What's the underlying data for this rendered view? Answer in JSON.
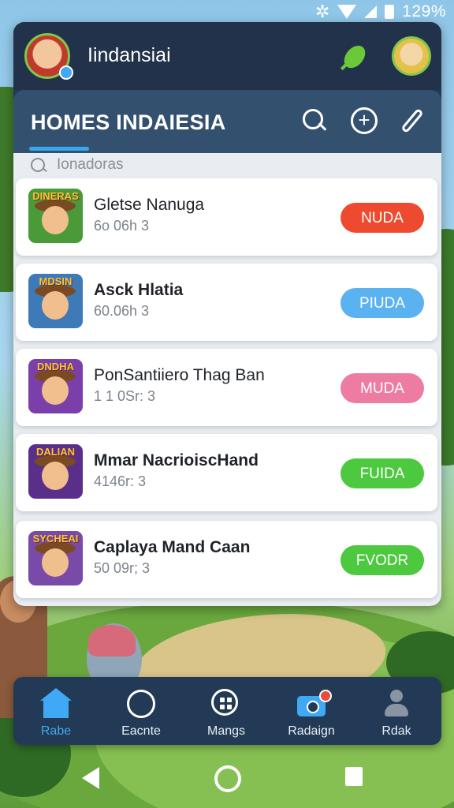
{
  "status": {
    "time": "129%"
  },
  "app": {
    "title": "Iindansiai"
  },
  "section": {
    "title": "HOMES INDAIESIA"
  },
  "search": {
    "placeholder": "Ionadoras"
  },
  "games": [
    {
      "title": "Gletse Nanuga",
      "meta": "6o 06h 3",
      "action": "NUDA",
      "action_color": "#ee4a2f",
      "thumb_text": "DINERAS",
      "thumb_bg": "#4a9a3a"
    },
    {
      "title": "Asck Hlatia",
      "meta": "60.06h 3",
      "action": "PIUDA",
      "action_color": "#5bb2f0",
      "thumb_text": "MDSIN",
      "thumb_bg": "#3f7ab8"
    },
    {
      "title": "PonSantiiero Thag Ban",
      "meta": "1 1 0Sr: 3",
      "action": "MUDA",
      "action_color": "#ee7ba1",
      "thumb_text": "DNDHA",
      "thumb_bg": "#7a3fa8"
    },
    {
      "title": "Mmar NacrioiscHand",
      "meta": "4146r: 3",
      "action": "FUIDA",
      "action_color": "#4cc93f",
      "thumb_text": "DALIAN",
      "thumb_bg": "#5a2f8a"
    },
    {
      "title": "Caplaya Mand Caan",
      "meta": "50 09r; 3",
      "action": "FVODR",
      "action_color": "#4cc93f",
      "thumb_text": "SYCHEAI",
      "thumb_bg": "#7a4aa8"
    }
  ],
  "nav": [
    {
      "label": "Rabe",
      "icon": "home-icon",
      "active": true
    },
    {
      "label": "Eacnte",
      "icon": "explore-icon",
      "active": false
    },
    {
      "label": "Mangs",
      "icon": "apps-grid-icon",
      "active": false
    },
    {
      "label": "Radaign",
      "icon": "camera-icon",
      "active": false
    },
    {
      "label": "Rdak",
      "icon": "profile-icon",
      "active": false
    }
  ]
}
